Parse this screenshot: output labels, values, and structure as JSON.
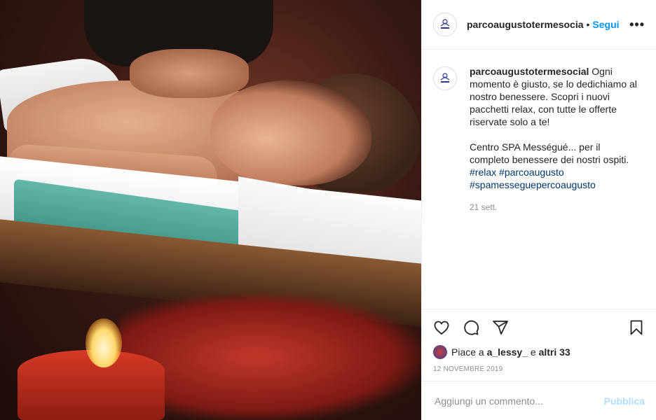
{
  "post": {
    "username": "parcoaugustotermesocia",
    "dot": "•",
    "follow_label": "Segui",
    "more_label": "•••"
  },
  "caption": {
    "username": "parcoaugustotermesocial",
    "text_1": "Ogni momento è giusto, se lo dedichiamo al nostro benessere. Scopri i nuovi pacchetti relax, con tutte le offerte riservate solo a te!",
    "text_2": "Centro SPA Mességué... per il completo benessere dei nostri ospiti.",
    "hashtags": [
      "#relax",
      "#parcoaugusto",
      "#spamesseguepercoaugusto"
    ],
    "time": "21 sett."
  },
  "likes": {
    "prefix": "Piace a",
    "user": "a_lessy_",
    "middle": "e",
    "others": "altri 33"
  },
  "date": "12 NOVEMBRE 2019",
  "comment_box": {
    "placeholder": "Aggiungi un commento...",
    "publish_label": "Pubblica"
  },
  "colors": {
    "accent": "#0095f6",
    "publish_disabled": "#b2dffc",
    "hashtag": "#00376b"
  }
}
